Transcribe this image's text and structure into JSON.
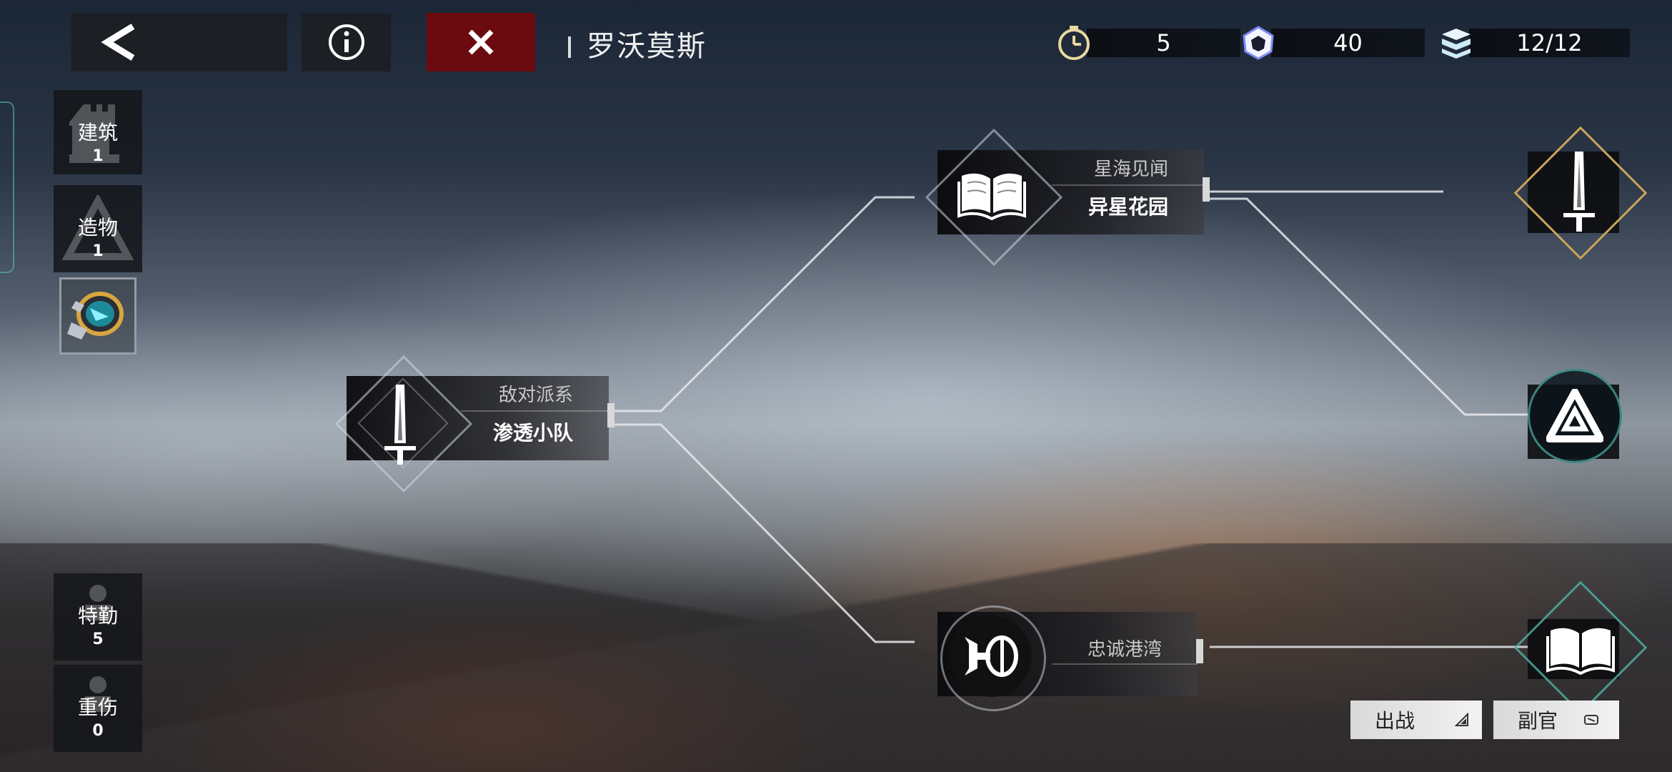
{
  "header": {
    "stage_title": "罗沃莫斯"
  },
  "resources": [
    {
      "icon": "stopwatch-icon",
      "value": "5"
    },
    {
      "icon": "crystal-icon",
      "value": "40"
    },
    {
      "icon": "layers-icon",
      "value": "12/12"
    }
  ],
  "sidebar": {
    "building": {
      "label": "建筑",
      "count": "1"
    },
    "artifact": {
      "label": "造物",
      "count": "1"
    },
    "agents": {
      "label": "特勤",
      "count": "5"
    },
    "injured": {
      "label": "重伤",
      "count": "0"
    }
  },
  "nodes": {
    "start": {
      "category": "敌对派系",
      "name": "渗透小队",
      "icon": "sword-icon"
    },
    "upper": {
      "category": "星海见闻",
      "name": "异星花园",
      "icon": "book-icon"
    },
    "lower": {
      "name": "忠诚港湾",
      "icon": "satellite-icon"
    }
  },
  "footer": {
    "deploy_label": "出战",
    "deputy_label": "副官"
  },
  "colors": {
    "close_button": "#6b0b0f",
    "gold_accent": "#c9a45a",
    "teal_accent": "#4fb3a8"
  }
}
